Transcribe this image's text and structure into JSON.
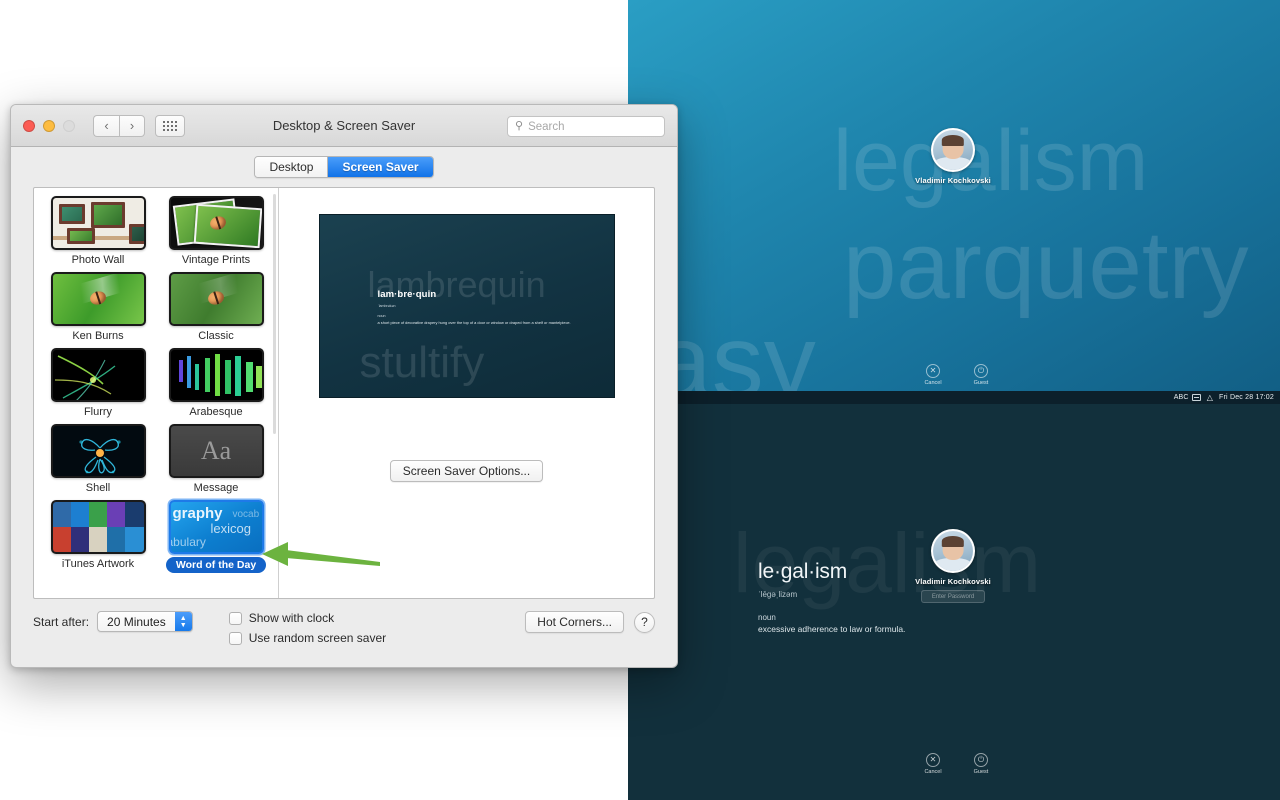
{
  "window": {
    "title": "Desktop & Screen Saver",
    "traffic_lights": [
      "close",
      "minimize",
      "zoom"
    ],
    "nav": {
      "back": "‹",
      "forward": "›",
      "grid": "grid-view"
    },
    "search": {
      "placeholder": "Search",
      "value": ""
    },
    "tabs": [
      {
        "label": "Desktop",
        "active": false
      },
      {
        "label": "Screen Saver",
        "active": true
      }
    ]
  },
  "screensavers": [
    {
      "label": "Photo Wall",
      "selected": false
    },
    {
      "label": "Vintage Prints",
      "selected": false
    },
    {
      "label": "Ken Burns",
      "selected": false
    },
    {
      "label": "Classic",
      "selected": false
    },
    {
      "label": "Flurry",
      "selected": false
    },
    {
      "label": "Arabesque",
      "selected": false
    },
    {
      "label": "Shell",
      "selected": false
    },
    {
      "label": "Message",
      "selected": false
    },
    {
      "label": "iTunes Artwork",
      "selected": false
    },
    {
      "label": "Word of the Day",
      "selected": true
    }
  ],
  "thumb_wotd_words": [
    "graphy",
    "vocab",
    "lexicog",
    "abulary"
  ],
  "message_thumb_glyph": "Aa",
  "preview": {
    "ghost_top": "lambrequin",
    "ghost_bottom": "stultify",
    "word": "lam·bre·quin",
    "phonetic": "ˈlambrəkən",
    "part_of_speech": "noun",
    "definition": "a short piece of decorative drapery hung over the top of a door or window or draped from a shelf or mantelpiece."
  },
  "options_button": "Screen Saver Options...",
  "bottom": {
    "start_after_label": "Start after:",
    "start_after_value": "20 Minutes",
    "show_with_clock": {
      "label": "Show with clock",
      "checked": false
    },
    "use_random": {
      "label": "Use random screen saver",
      "checked": false
    },
    "hot_corners": "Hot Corners...",
    "help": "?"
  },
  "login_screen": {
    "ghost_words_top": [
      "legalism",
      "parquetry",
      "stasy"
    ],
    "ghost_word_bottom": "legalism",
    "user_name": "Vladimir Kochkovski",
    "password_placeholder": "Enter Password",
    "actions": [
      {
        "label": "Cancel",
        "glyph": "✕"
      },
      {
        "label": "Guest",
        "glyph": "⏻"
      }
    ],
    "definition": {
      "word": "le·gal·ism",
      "phonetic": "ˈlēgəˌlizəm",
      "part_of_speech": "noun",
      "meaning": "excessive adherence to law or formula."
    },
    "menubar": {
      "input_source": "ABC",
      "keyboard_icon": "keyboard-icon",
      "wifi_icon": "wifi-icon",
      "clock": "Fri Dec 28  17:02"
    }
  },
  "annotation": {
    "arrow": "green-left-arrow",
    "color": "#6cb33f"
  }
}
